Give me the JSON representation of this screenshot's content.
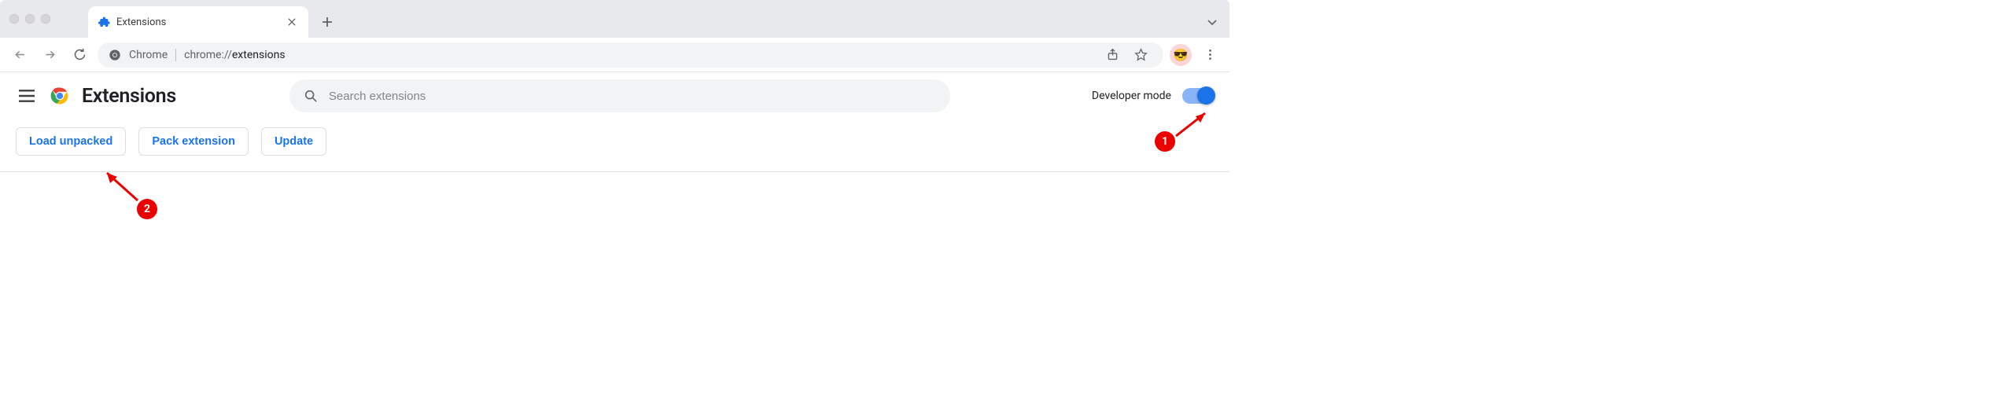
{
  "tab": {
    "title": "Extensions"
  },
  "omnibox": {
    "chip": "Chrome",
    "url_prefix": "chrome://",
    "url_bold": "extensions",
    "url_suffix": ""
  },
  "page": {
    "title": "Extensions",
    "search_placeholder": "Search extensions",
    "developer_mode_label": "Developer mode",
    "actions": {
      "load_unpacked": "Load unpacked",
      "pack_extension": "Pack extension",
      "update": "Update"
    }
  },
  "annotations": {
    "one": "1",
    "two": "2"
  }
}
